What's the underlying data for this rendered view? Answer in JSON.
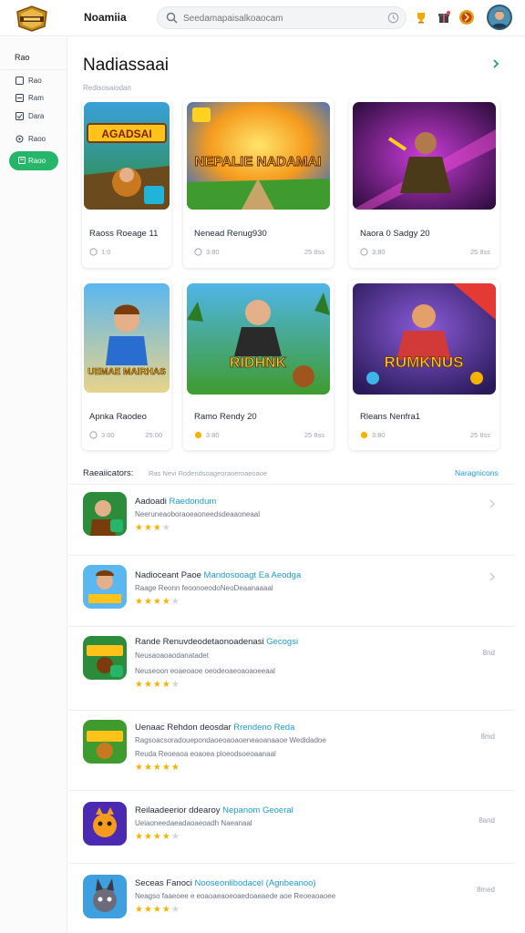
{
  "header": {
    "app_title": "Noamiia",
    "search_placeholder": "Seedamapaisalkoaocam"
  },
  "sidebar": {
    "heading": "Rao",
    "items": [
      {
        "label": "Rao",
        "icon": "square-icon"
      },
      {
        "label": "Ram",
        "icon": "list-icon"
      },
      {
        "label": "Dara",
        "icon": "check-icon"
      },
      {
        "label": "Raoo",
        "icon": "gear-icon"
      }
    ],
    "button_label": "Raoo"
  },
  "main": {
    "title": "Nadiassaai",
    "subtitle": "Redisosaiodan",
    "featured": [
      {
        "title": "Raoss Roeage 11",
        "meta": "1:0",
        "size": ""
      },
      {
        "title": "Nenead Renug930",
        "meta": "3:80",
        "size": "25 8ss"
      },
      {
        "title": "Naora 0 Sadgy 20",
        "meta": "3:80",
        "size": "25 8ss"
      },
      {
        "title": "Apnka Raodeo",
        "meta": "3:00",
        "size": "25:00"
      },
      {
        "title": "Ramo Rendy 20",
        "meta": "3:80",
        "size": "25 8ss"
      },
      {
        "title": "Rleans Nenfra1",
        "meta": "3:80",
        "size": "25 8ss"
      }
    ],
    "thumb_texts": [
      "AGADSAI",
      "NEPALIE NADAMAI",
      "",
      "UEMAE MAIRHAS",
      "RIDHNK",
      "RUMKNUS"
    ],
    "recommendations_heading": "Raeaiicators:",
    "recommendations_sub": "Ras Nevi Rodendsoageoraoeroaeoaoe",
    "recommendations_link": "Naragnicons",
    "recommendations": [
      {
        "title": "Aadoadi",
        "title_hl": "Raedondum",
        "desc": "Neeruneaoboraoeaoneedsdeaaoneaal",
        "stars": 3,
        "right": ""
      },
      {
        "title": "Nadioceant Paoe",
        "title_hl": "Mandosooagt Ea Aeodga",
        "desc": "Raage Reonn feoonoeodoNeoDeaanaaaal",
        "stars": 4,
        "right": ""
      },
      {
        "title": "Rande Renuvdeodetaonoadenasi",
        "title_hl": "Gecogsi",
        "desc": "Neusaoaoaodanatadet",
        "desc2": "Neuseoon eoaeoaoe oeodeoaeoaoaoeeaal",
        "stars": 4,
        "right": "8nd"
      },
      {
        "title": "Uenaac Rehdon deosdar",
        "title_hl": "Rrendeno Reda",
        "desc": "Ragsoacsoradouepondaoeoaoaoeneaoanaaoe Wedidadoe",
        "desc2": "Reuda Reoeaoa eoaoea ploeodsoeoaanaal",
        "stars": 5,
        "right": "8md"
      },
      {
        "title": "Reilaadeerior ddearoy",
        "title_hl": "Nepanom Geoeral",
        "desc": "Ueiaoneedaeadaoaeoadh Naeanaal",
        "stars": 4,
        "right": "8and"
      },
      {
        "title": "Seceas Fanoci",
        "title_hl": "Nooseonlibodacel (Agnbeanoo)",
        "desc": "Neagso faaeoee e eoaoaeaoeoaedoaeaede aoe Reoeaoaoee",
        "stars": 4,
        "right": "8med"
      }
    ]
  },
  "colors": {
    "accent": "#1d9bd1",
    "primary_button": "#25b66a",
    "star": "#f5b301"
  }
}
